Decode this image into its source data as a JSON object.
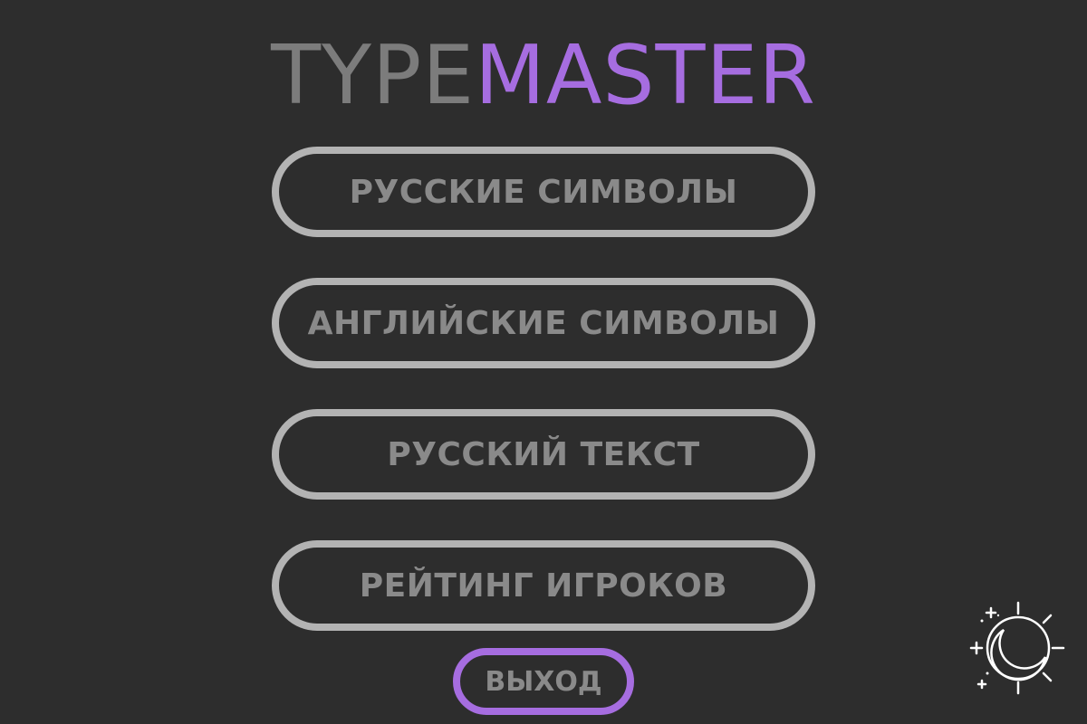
{
  "logo": {
    "part_a": "TYPE",
    "part_b": "MASTER"
  },
  "menu": {
    "items": [
      {
        "label": "РУССКИЕ СИМВОЛЫ"
      },
      {
        "label": "АНГЛИЙСКИЕ СИМВОЛЫ"
      },
      {
        "label": "РУССКИЙ ТЕКСТ"
      },
      {
        "label": "РЕЙТИНГ ИГРОКОВ"
      }
    ],
    "exit_label": "ВЫХОД"
  },
  "theme_toggle": {
    "icon": "moon-sun-icon"
  },
  "colors": {
    "background": "#2d2d2d",
    "logo_gray": "#7c7c7c",
    "accent_purple": "#a66de0",
    "button_border": "#b3b3b3",
    "button_text": "#8a8a8a",
    "icon_white": "#ffffff"
  }
}
